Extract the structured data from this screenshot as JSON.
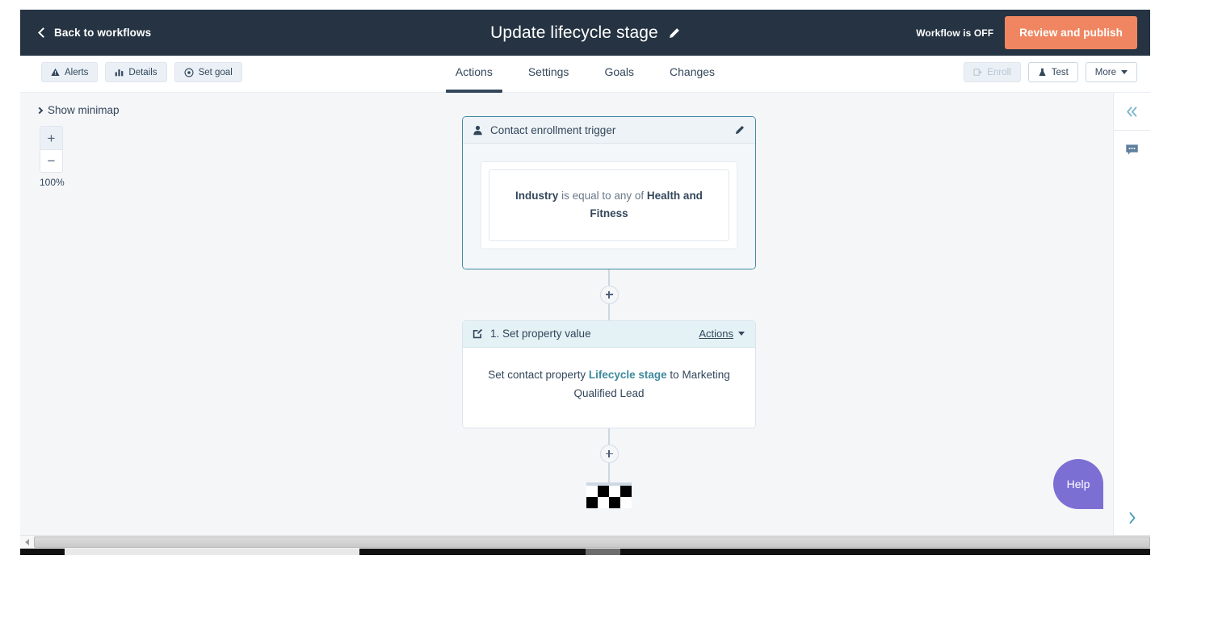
{
  "topbar": {
    "back_label": "Back to workflows",
    "back_icon": "chevron-left-icon",
    "workflow_title": "Update lifecycle stage",
    "edit_title_icon": "pencil-icon",
    "status_label": "Workflow is OFF",
    "publish_label": "Review and publish",
    "publish_color": "#ef8661",
    "background_color": "#253342"
  },
  "toolbar": {
    "left_buttons": [
      {
        "label": "Alerts",
        "icon": "alert-triangle-icon",
        "disabled": false
      },
      {
        "label": "Details",
        "icon": "bar-chart-icon",
        "disabled": false
      },
      {
        "label": "Set goal",
        "icon": "target-icon",
        "disabled": false
      }
    ],
    "tabs": [
      {
        "label": "Actions",
        "active": true
      },
      {
        "label": "Settings",
        "active": false
      },
      {
        "label": "Goals",
        "active": false
      },
      {
        "label": "Changes",
        "active": false
      }
    ],
    "right_buttons": [
      {
        "label": "Enroll",
        "icon": "enroll-icon",
        "disabled": true
      },
      {
        "label": "Test",
        "icon": "flask-icon",
        "disabled": false
      },
      {
        "label": "More",
        "icon": "caret-down-icon",
        "disabled": false
      }
    ]
  },
  "canvas": {
    "minimap_label": "Show minimap",
    "minimap_icon": "chevron-right-icon",
    "zoom_in_label": "+",
    "zoom_out_label": "−",
    "zoom_level": "100%",
    "background_color": "#f5f6f8"
  },
  "flow": {
    "trigger": {
      "icon": "contact-person-icon",
      "title": "Contact enrollment trigger",
      "edit_icon": "pencil-icon",
      "border_color": "#3d8a9e",
      "filter": {
        "property": "Industry",
        "operator": "is equal to any of",
        "value": "Health and Fitness"
      }
    },
    "connector_add_icon": "plus-icon",
    "action": {
      "icon": "edit-square-icon",
      "title": "1. Set property value",
      "actions_menu_label": "Actions",
      "actions_menu_icon": "caret-down-icon",
      "description_prefix": "Set contact property",
      "description_property": "Lifecycle stage",
      "description_middle": "to",
      "description_value": "Marketing Qualified Lead",
      "property_color": "#3d8a9e"
    },
    "end_marker": "checkered-flag-icon"
  },
  "right_rail": {
    "collapse_icon": "double-chevron-left-icon",
    "comments_icon": "comment-bubble-icon",
    "expand_icon": "chevron-right-icon"
  },
  "help": {
    "label": "Help",
    "color": "#7c6fd4"
  }
}
